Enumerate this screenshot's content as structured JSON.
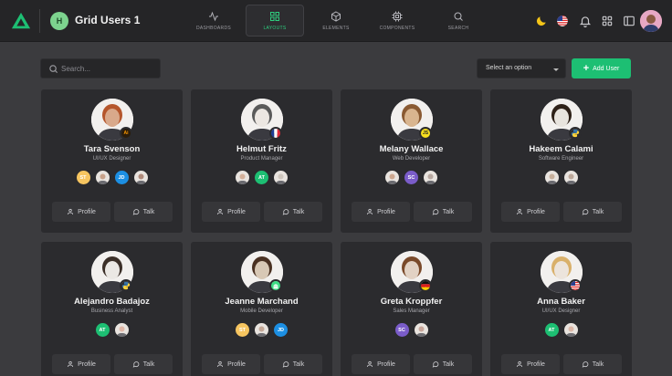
{
  "app": {
    "workspace_initial": "H",
    "workspace_title": "Grid Users 1",
    "accent": "#1dbf73"
  },
  "nav": [
    {
      "label": "DASHBOARDS",
      "icon": "activity-icon",
      "active": false
    },
    {
      "label": "LAYOUTS",
      "icon": "grid-icon",
      "active": true
    },
    {
      "label": "ELEMENTS",
      "icon": "box-icon",
      "active": false
    },
    {
      "label": "COMPONENTS",
      "icon": "cpu-icon",
      "active": false
    },
    {
      "label": "SEARCH",
      "icon": "search-icon",
      "active": false
    }
  ],
  "topbar_icons": [
    "moon-icon",
    "us-flag-icon",
    "bell-icon",
    "apps-grid-icon",
    "sidebar-toggle-icon"
  ],
  "toolbar": {
    "search_placeholder": "Search...",
    "select_value": "Select an option",
    "add_label": "Add User"
  },
  "users": [
    {
      "name": "Tara Svenson",
      "role": "UI/UX Designer",
      "badge": "Ai",
      "badge_bg": "#2a1c0b",
      "badge_fg": "#ff9a00",
      "photo_bg": "#d9a98b",
      "hair": "#b5562c",
      "team": [
        {
          "initials": "ST",
          "bg": "#f6c560"
        },
        {
          "photo": "#c9a28a"
        },
        {
          "initials": "JD",
          "bg": "#1c8fe3"
        },
        {
          "photo": "#b08a7a"
        }
      ]
    },
    {
      "name": "Helmut Fritz",
      "role": "Product Manager",
      "badge": "fr-flag",
      "photo_bg": "#ece7e2",
      "hair": "#5a5a5a",
      "team": [
        {
          "photo": "#d4b09a"
        },
        {
          "initials": "AT",
          "bg": "#1dbf73"
        },
        {
          "photo": "#cfc6bd"
        }
      ]
    },
    {
      "name": "Melany Wallace",
      "role": "Web Developer",
      "badge": "JS",
      "badge_bg": "#f7df1e",
      "badge_fg": "#222",
      "photo_bg": "#d9b58f",
      "hair": "#8a5a32",
      "team": [
        {
          "photo": "#cda78f"
        },
        {
          "initials": "SC",
          "bg": "#7a5cc9"
        },
        {
          "photo": "#b8a8a0"
        }
      ]
    },
    {
      "name": "Hakeem Calami",
      "role": "Software Engineer",
      "badge": "python",
      "photo_bg": "#e8e4de",
      "hair": "#2e2118",
      "team": [
        {
          "photo": "#c8b09c"
        },
        {
          "photo": "#bda89a"
        }
      ]
    },
    {
      "name": "Alejandro Badajoz",
      "role": "Business Analyst",
      "badge": "python",
      "photo_bg": "#ebe8e4",
      "hair": "#3b2f28",
      "team": [
        {
          "initials": "AT",
          "bg": "#1dbf73"
        },
        {
          "photo": "#e0b8a8"
        }
      ]
    },
    {
      "name": "Jeanne Marchand",
      "role": "Mobile Developer",
      "badge": "android",
      "photo_bg": "#d8c8b5",
      "hair": "#4a3122",
      "team": [
        {
          "initials": "ST",
          "bg": "#f6c560"
        },
        {
          "photo": "#c4a897"
        },
        {
          "initials": "JD",
          "bg": "#1c8fe3"
        }
      ]
    },
    {
      "name": "Greta Kroppfer",
      "role": "Sales Manager",
      "badge": "de-flag",
      "photo_bg": "#e2d2c4",
      "hair": "#7a4a2a",
      "team": [
        {
          "initials": "SC",
          "bg": "#7a5cc9"
        },
        {
          "photo": "#c8a69a"
        }
      ]
    },
    {
      "name": "Anna Baker",
      "role": "UI/UX Designer",
      "badge": "us-flag",
      "photo_bg": "#ece4dc",
      "hair": "#d9b06a",
      "team": [
        {
          "initials": "AT",
          "bg": "#1dbf73"
        },
        {
          "photo": "#dcb8a8"
        }
      ]
    }
  ],
  "card_actions": {
    "profile": "Profile",
    "talk": "Talk"
  }
}
